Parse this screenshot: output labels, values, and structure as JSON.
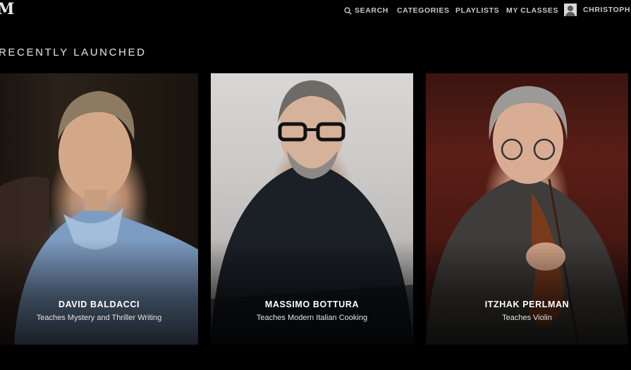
{
  "brand": {
    "logo_text": "M"
  },
  "nav": {
    "search_label": "SEARCH",
    "categories_label": "CATEGORIES",
    "playlists_label": "PLAYLISTS",
    "my_classes_label": "MY CLASSES",
    "user_name": "CHRISTOPH"
  },
  "section": {
    "title": "RECENTLY LAUNCHED"
  },
  "cards": [
    {
      "name": "DAVID BALDACCI",
      "subtitle": "Teaches Mystery and Thriller Writing"
    },
    {
      "name": "MASSIMO BOTTURA",
      "subtitle": "Teaches Modern Italian Cooking"
    },
    {
      "name": "ITZHAK PERLMAN",
      "subtitle": "Teaches Violin"
    }
  ],
  "colors": {
    "background": "#000000",
    "nav_text": "#c9c9c9",
    "title_text": "#e6e6e6"
  }
}
